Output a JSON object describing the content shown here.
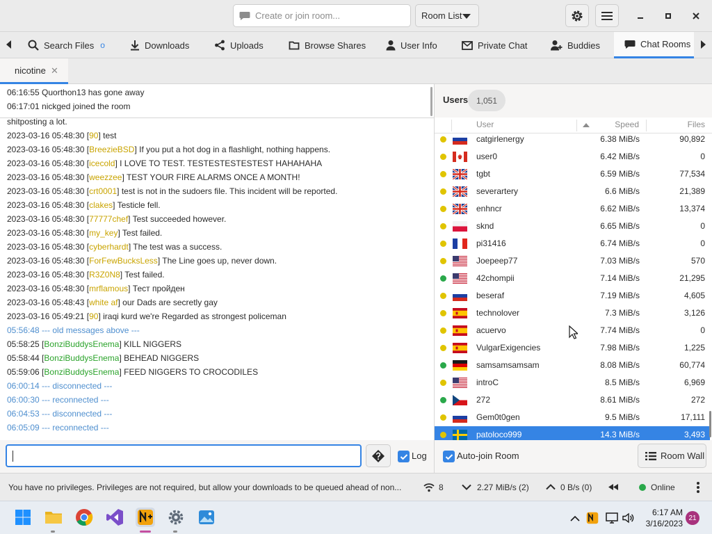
{
  "header": {
    "room_placeholder": "Create or join room...",
    "room_list_label": "Room List",
    "icons": [
      "chat-bubble-icon",
      "chevron-down-icon",
      "gear-icon",
      "hamburger-menu-icon",
      "minimize-icon",
      "maximize-icon",
      "close-icon"
    ]
  },
  "tabs": [
    {
      "label": "Search Files",
      "icon": "search-icon",
      "indicator": "o"
    },
    {
      "label": "Downloads",
      "icon": "download-icon"
    },
    {
      "label": "Uploads",
      "icon": "share-icon"
    },
    {
      "label": "Browse Shares",
      "icon": "folder-icon"
    },
    {
      "label": "User Info",
      "icon": "person-icon"
    },
    {
      "label": "Private Chat",
      "icon": "mail-icon"
    },
    {
      "label": "Buddies",
      "icon": "person-add-icon"
    },
    {
      "label": "Chat Rooms",
      "icon": "chat-bubble-icon",
      "active": true
    }
  ],
  "room_tab": {
    "label": "nicotine"
  },
  "status_log": [
    "06:16:55 Quorthon13 has gone away",
    "06:17:01 nickged joined the room"
  ],
  "messages": [
    {
      "text": "shitposting a lot."
    },
    {
      "ts": "2023-03-16 05:48:30",
      "user": "90",
      "body": "test"
    },
    {
      "ts": "2023-03-16 05:48:30",
      "user": "BreezieBSD",
      "body": "If you put a hot dog in a flashlight, nothing happens."
    },
    {
      "ts": "2023-03-16 05:48:30",
      "user": "icecold",
      "body": "I LOVE TO TEST. TESTESTESTESTEST HAHAHAHA"
    },
    {
      "ts": "2023-03-16 05:48:30",
      "user": "weezzee",
      "body": "TEST YOUR FIRE ALARMS ONCE A MONTH!"
    },
    {
      "ts": "2023-03-16 05:48:30",
      "user": "crt0001",
      "body": "test is not in the sudoers file. This incident will be reported."
    },
    {
      "ts": "2023-03-16 05:48:30",
      "user": "clakes",
      "body": "Testicle fell."
    },
    {
      "ts": "2023-03-16 05:48:30",
      "user": "77777chef",
      "body": "Test succeeded however."
    },
    {
      "ts": "2023-03-16 05:48:30",
      "user": "my_key",
      "body": "Test failed."
    },
    {
      "ts": "2023-03-16 05:48:30",
      "user": "cyberhardt",
      "body": "The test was a success."
    },
    {
      "ts": "2023-03-16 05:48:30",
      "user": "ForFewBucksLess",
      "body": "The Line goes up, never down."
    },
    {
      "ts": "2023-03-16 05:48:30",
      "user": "R3Z0N8",
      "body": "Test failed."
    },
    {
      "ts": "2023-03-16 05:48:30",
      "user": "mrflamous",
      "body": "Тест пройден"
    },
    {
      "ts": "2023-03-16 05:48:43",
      "user": "white af",
      "body": "our Dads are secretly gay"
    },
    {
      "ts": "2023-03-16 05:49:21",
      "user": "90",
      "body": "iraqi kurd we're Regarded as strongest policeman"
    },
    {
      "sys": "05:56:48 --- old messages above ---"
    },
    {
      "ts": "05:58:25",
      "user": "BonziBuddysEnema",
      "body": "KILL NIGGERS",
      "online": true
    },
    {
      "ts": "05:58:44",
      "user": "BonziBuddysEnema",
      "body": "BEHEAD NIGGERS",
      "online": true
    },
    {
      "ts": "05:59:06",
      "user": "BonziBuddysEnema",
      "body": "FEED NIGGERS TO CROCODILES",
      "online": true
    },
    {
      "sys": "06:00:14 --- disconnected ---"
    },
    {
      "sys": "06:00:30 --- reconnected ---"
    },
    {
      "sys": "06:04:53 --- disconnected ---"
    },
    {
      "sys": "06:05:09 --- reconnected ---"
    }
  ],
  "entry": {
    "help_icon": "question-diamond-icon",
    "log_label": "Log",
    "log_checked": true
  },
  "users_panel": {
    "title": "Users",
    "count": "1,051",
    "columns": {
      "user": "User",
      "speed": "Speed",
      "files": "Files"
    },
    "sort": "speed-ascending",
    "rows": [
      {
        "name": "catgirlenergy",
        "speed": "6.38 MiB/s",
        "files": "90,892",
        "status": "away",
        "flag": "ru"
      },
      {
        "name": "user0",
        "speed": "6.42 MiB/s",
        "files": "0",
        "status": "away",
        "flag": "ca"
      },
      {
        "name": "tgbt",
        "speed": "6.59 MiB/s",
        "files": "77,534",
        "status": "away",
        "flag": "gb"
      },
      {
        "name": "severartery",
        "speed": "6.6 MiB/s",
        "files": "21,389",
        "status": "away",
        "flag": "gb"
      },
      {
        "name": "enhncr",
        "speed": "6.62 MiB/s",
        "files": "13,374",
        "status": "away",
        "flag": "gb"
      },
      {
        "name": "sknd",
        "speed": "6.65 MiB/s",
        "files": "0",
        "status": "away",
        "flag": "pl"
      },
      {
        "name": "pi31416",
        "speed": "6.74 MiB/s",
        "files": "0",
        "status": "away",
        "flag": "fr"
      },
      {
        "name": "Joepeep77",
        "speed": "7.03 MiB/s",
        "files": "570",
        "status": "away",
        "flag": "us"
      },
      {
        "name": "42chompii",
        "speed": "7.14 MiB/s",
        "files": "21,295",
        "status": "online",
        "flag": "us"
      },
      {
        "name": "beseraf",
        "speed": "7.19 MiB/s",
        "files": "4,605",
        "status": "away",
        "flag": "ru"
      },
      {
        "name": "technolover",
        "speed": "7.3 MiB/s",
        "files": "3,126",
        "status": "away",
        "flag": "es"
      },
      {
        "name": "acuervo",
        "speed": "7.74 MiB/s",
        "files": "0",
        "status": "away",
        "flag": "es"
      },
      {
        "name": "VulgarExigencies",
        "speed": "7.98 MiB/s",
        "files": "1,225",
        "status": "away",
        "flag": "es"
      },
      {
        "name": "samsamsamsam",
        "speed": "8.08 MiB/s",
        "files": "60,774",
        "status": "online",
        "flag": "de"
      },
      {
        "name": "introC",
        "speed": "8.5 MiB/s",
        "files": "6,969",
        "status": "away",
        "flag": "us"
      },
      {
        "name": "272",
        "speed": "8.61 MiB/s",
        "files": "272",
        "status": "online",
        "flag": "cz"
      },
      {
        "name": "Gem0t0gen",
        "speed": "9.5 MiB/s",
        "files": "17,111",
        "status": "away",
        "flag": "ru"
      },
      {
        "name": "patoloco999",
        "speed": "14.3 MiB/s",
        "files": "3,493",
        "status": "away",
        "flag": "se",
        "selected": true
      }
    ],
    "autojoin_label": "Auto-join Room",
    "autojoin_checked": true,
    "room_wall_label": "Room Wall"
  },
  "statusbar": {
    "message": "You have no privileges. Privileges are not required, but allow your downloads to be queued ahead of non...",
    "connections": "8",
    "download": "2.27 MiB/s (2)",
    "upload": "0 B/s (0)",
    "status": "Online"
  },
  "taskbar": {
    "time": "6:17 AM",
    "date": "3/16/2023",
    "notifications": "21"
  },
  "colors": {
    "accent": "#3584e4",
    "username": "#c9a400",
    "online_user": "#2ba32b",
    "system_msg": "#4f8fcf",
    "status_away": "#e0c400",
    "status_online": "#2aa84a"
  }
}
